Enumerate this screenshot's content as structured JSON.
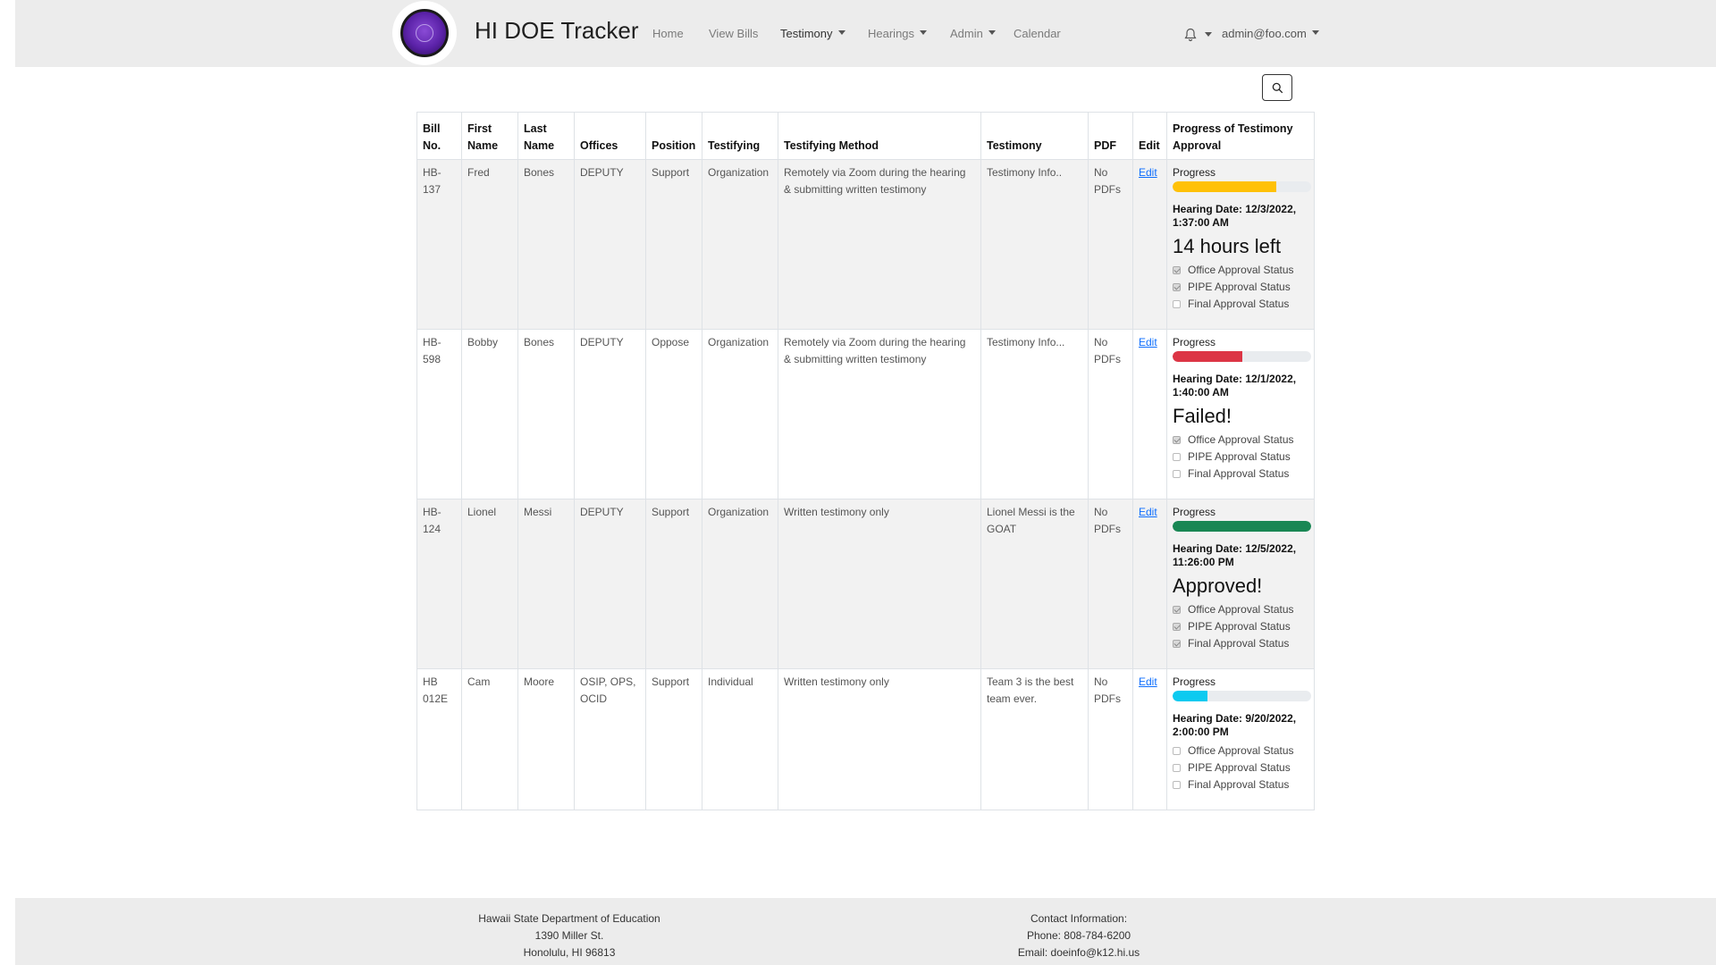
{
  "app": {
    "title": "HI DOE Tracker"
  },
  "nav": {
    "home": "Home",
    "view_bills": "View Bills",
    "testimony": "Testimony",
    "hearings": "Hearings",
    "admin": "Admin",
    "calendar": "Calendar",
    "user": "admin@foo.com"
  },
  "table": {
    "headers": {
      "bill_no": "Bill No.",
      "first_name": "First Name",
      "last_name": "Last Name",
      "offices": "Offices",
      "position": "Position",
      "testifying": "Testifying",
      "method": "Testifying Method",
      "testimony": "Testimony",
      "pdf": "PDF",
      "edit": "Edit",
      "progress": "Progress of Testimony Approval"
    },
    "rows": [
      {
        "bill": "HB-137",
        "first": "Fred",
        "last": "Bones",
        "offices": "DEPUTY",
        "position": "Support",
        "testifying": "Organization",
        "method": "Remotely via Zoom during the hearing & submitting written testimony",
        "testimony": "Testimony Info..",
        "pdf": "No PDFs",
        "edit": "Edit",
        "progress_label": "Progress",
        "progress": 0.75,
        "color": "#ffc107",
        "hearing": "Hearing Date: 12/3/2022, 1:37:00 AM",
        "status": "14 hours left",
        "office": "Office Approval Status",
        "pipe": "PIPE Approval Status",
        "final": "Final Approval Status",
        "office_checked": true,
        "pipe_checked": true,
        "final_checked": false
      },
      {
        "bill": "HB-598",
        "first": "Bobby",
        "last": "Bones",
        "offices": "DEPUTY",
        "position": "Oppose",
        "testifying": "Organization",
        "method": "Remotely via Zoom during the hearing & submitting written testimony",
        "testimony": "Testimony Info...",
        "pdf": "No PDFs",
        "edit": "Edit",
        "progress_label": "Progress",
        "progress": 0.5,
        "color": "#dc3545",
        "hearing": "Hearing Date: 12/1/2022, 1:40:00 AM",
        "status": "Failed!",
        "office": "Office Approval Status",
        "pipe": "PIPE Approval Status",
        "final": "Final Approval Status",
        "office_checked": true,
        "pipe_checked": false,
        "final_checked": false
      },
      {
        "bill": "HB-124",
        "first": "Lionel",
        "last": "Messi",
        "offices": "DEPUTY",
        "position": "Support",
        "testifying": "Organization",
        "method": "Written testimony only",
        "testimony": "Lionel Messi is the GOAT",
        "pdf": "No PDFs",
        "edit": "Edit",
        "progress_label": "Progress",
        "progress": 1.0,
        "color": "#198754",
        "hearing": "Hearing Date: 12/5/2022, 11:26:00 PM",
        "status": "Approved!",
        "office": "Office Approval Status",
        "pipe": "PIPE Approval Status",
        "final": "Final Approval Status",
        "office_checked": true,
        "pipe_checked": true,
        "final_checked": true
      },
      {
        "bill": "HB 012E",
        "first": "Cam",
        "last": "Moore",
        "offices": "OSIP, OPS, OCID",
        "position": "Support",
        "testifying": "Individual",
        "method": "Written testimony only",
        "testimony": "Team 3 is the best team ever.",
        "pdf": "No PDFs",
        "edit": "Edit",
        "progress_label": "Progress",
        "progress": 0.25,
        "color": "#0dcaf0",
        "hearing": "Hearing Date: 9/20/2022, 2:00:00 PM",
        "status": "",
        "office": "Office Approval Status",
        "pipe": "PIPE Approval Status",
        "final": "Final Approval Status",
        "office_checked": false,
        "pipe_checked": false,
        "final_checked": false
      }
    ]
  },
  "footer": {
    "org": "Hawaii State Department of Education",
    "street": "1390 Miller St.",
    "city": "Honolulu, HI 96813",
    "contact": "Contact Information:",
    "phone": "Phone: 808-784-6200",
    "email": "Email: doeinfo@k12.hi.us"
  }
}
